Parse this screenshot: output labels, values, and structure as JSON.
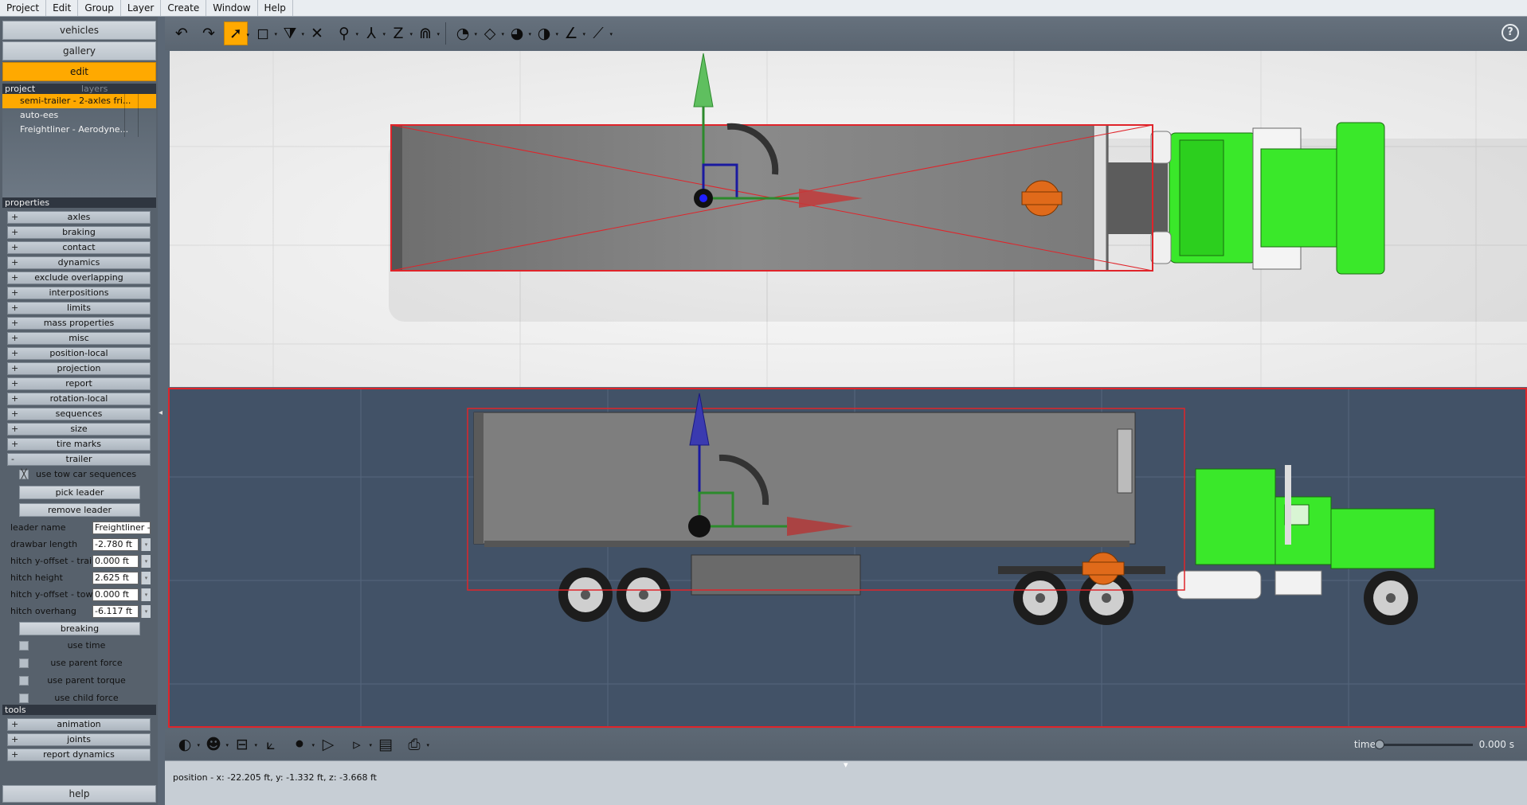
{
  "menu": [
    "Project",
    "Edit",
    "Group",
    "Layer",
    "Create",
    "Window",
    "Help"
  ],
  "nav": {
    "vehicles": "vehicles",
    "gallery": "gallery",
    "edit": "edit"
  },
  "project_tabs": {
    "project": "project",
    "layers": "layers"
  },
  "project_items": [
    "semi-trailer - 2-axles fri...",
    "auto-ees",
    "Freightliner - Aerodyne..."
  ],
  "properties_header": "properties",
  "properties": [
    {
      "sign": "+",
      "label": "axles"
    },
    {
      "sign": "+",
      "label": "braking"
    },
    {
      "sign": "+",
      "label": "contact"
    },
    {
      "sign": "+",
      "label": "dynamics"
    },
    {
      "sign": "+",
      "label": "exclude overlapping"
    },
    {
      "sign": "+",
      "label": "interpositions"
    },
    {
      "sign": "+",
      "label": "limits"
    },
    {
      "sign": "+",
      "label": "mass properties"
    },
    {
      "sign": "+",
      "label": "misc"
    },
    {
      "sign": "+",
      "label": "position-local"
    },
    {
      "sign": "+",
      "label": "projection"
    },
    {
      "sign": "+",
      "label": "report"
    },
    {
      "sign": "+",
      "label": "rotation-local"
    },
    {
      "sign": "+",
      "label": "sequences"
    },
    {
      "sign": "+",
      "label": "size"
    },
    {
      "sign": "+",
      "label": "tire marks"
    },
    {
      "sign": "-",
      "label": "trailer"
    }
  ],
  "trailer": {
    "use_tow_car_sequences": {
      "label": "use tow car sequences",
      "mark": "╳"
    },
    "pick_leader": "pick leader",
    "remove_leader": "remove leader",
    "fields": [
      {
        "label": "leader name",
        "value": "Freightliner - A"
      },
      {
        "label": "drawbar length",
        "value": "-2.780 ft"
      },
      {
        "label": "hitch y-offset - trai...",
        "value": "0.000 ft"
      },
      {
        "label": "hitch height",
        "value": "2.625 ft"
      },
      {
        "label": "hitch y-offset - tow...",
        "value": "0.000 ft"
      },
      {
        "label": "hitch overhang",
        "value": "-6.117 ft"
      }
    ],
    "breaking": "breaking",
    "checks": [
      "use time",
      "use parent force",
      "use parent torque",
      "use child force"
    ]
  },
  "tools_header": "tools",
  "tools": [
    {
      "sign": "+",
      "label": "animation"
    },
    {
      "sign": "+",
      "label": "joints"
    },
    {
      "sign": "+",
      "label": "report dynamics"
    }
  ],
  "help": "help",
  "help_icon": "?",
  "time": {
    "label": "time",
    "value": "0.000 s",
    "progress": 0
  },
  "status_text": "position - x: -22.205 ft, y: -1.332 ft, z: -3.668 ft",
  "colors": {
    "accent": "#ffa900",
    "truck": "#33dd22",
    "selection": "#e0242a",
    "hitch": "#e06a1a"
  }
}
